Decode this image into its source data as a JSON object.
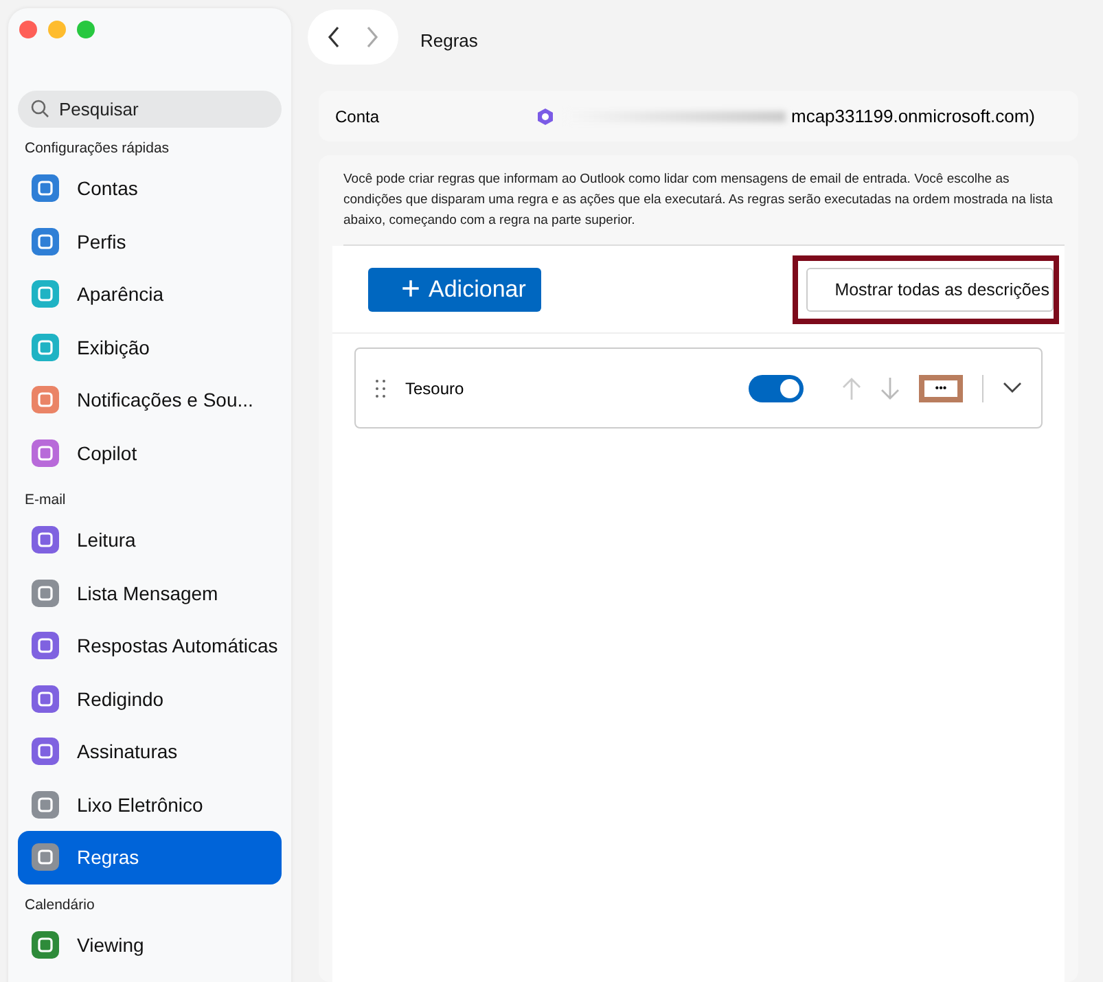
{
  "window": {
    "title": "Regras"
  },
  "sidebar": {
    "search": {
      "placeholder": "Pesquisar"
    },
    "sections": [
      {
        "title": "Configurações rápidas",
        "items": [
          {
            "label": "Contas",
            "color": "#2f7fd6",
            "selected": false
          },
          {
            "label": "Perfis",
            "color": "#2f7fd6",
            "selected": false
          },
          {
            "label": "Aparência",
            "color": "#1fb3c4",
            "selected": false
          },
          {
            "label": "Exibição",
            "color": "#1fb3c4",
            "selected": false
          },
          {
            "label": "Notificações e Sou...",
            "color": "#ea8466",
            "selected": false
          },
          {
            "label": "Copilot",
            "color": "#b86ad9",
            "selected": false
          }
        ]
      },
      {
        "title": "E-mail",
        "items": [
          {
            "label": "Leitura",
            "color": "#7f62e0",
            "selected": false
          },
          {
            "label": "Lista Mensagem",
            "color": "#8a8f96",
            "selected": false
          },
          {
            "label": "Respostas Automáticas",
            "color": "#7f62e0",
            "selected": false
          },
          {
            "label": "Redigindo",
            "color": "#7f62e0",
            "selected": false
          },
          {
            "label": "Assinaturas",
            "color": "#7f62e0",
            "selected": false
          },
          {
            "label": "Lixo Eletrônico",
            "color": "#8a8f96",
            "selected": false
          },
          {
            "label": "Regras",
            "color": "#8a8f96",
            "selected": true
          }
        ]
      },
      {
        "title": "Calendário",
        "items": [
          {
            "label": "Viewing",
            "color": "#2e8b3a",
            "selected": false
          }
        ]
      }
    ]
  },
  "account": {
    "label": "Conta",
    "value": "mcap331199.onmicrosoft.com)"
  },
  "description": "Você pode criar regras que informam ao Outlook como lidar com mensagens de email de entrada. Você escolhe as condições que disparam uma regra e as ações que ela executará. As regras serão executadas na ordem mostrada na lista abaixo, começando com a regra na parte superior.",
  "buttons": {
    "add": "Adicionar",
    "add_icon": "+",
    "show_all": "Mostrar todas as descrições"
  },
  "rules": [
    {
      "name": "Tesouro",
      "on": true,
      "more": "•••"
    }
  ]
}
